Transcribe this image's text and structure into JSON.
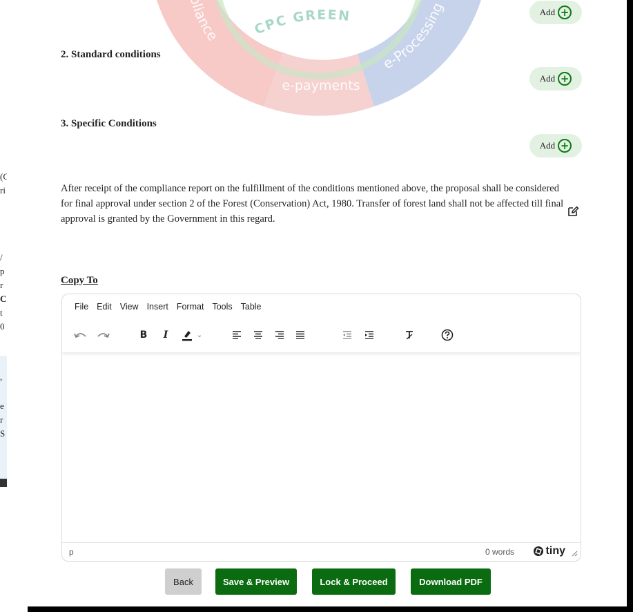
{
  "sections": [
    {
      "title": "2. Standard conditions",
      "add_label": "Add"
    },
    {
      "title": "3. Specific Conditions",
      "add_label": "Add"
    }
  ],
  "top_add_label": "Add",
  "watermark": {
    "center": "CPC GREEN",
    "left": "Compliance",
    "middle": "e-payments",
    "right": "e-Processing",
    "colors": {
      "red": "#f4b8b6",
      "blue": "#b9c7e6",
      "green": "#c9e5c5"
    }
  },
  "paragraph": "After receipt of the compliance report on the fulfillment of the conditions mentioned above, the proposal shall be considered for final approval under section 2 of the Forest (Conservation) Act, 1980. Transfer of forest land shall not be affected till final approval is granted by the Government in this regard.",
  "copy_to_label": "Copy To",
  "editor": {
    "menus": [
      "File",
      "Edit",
      "View",
      "Insert",
      "Format",
      "Tools",
      "Table"
    ],
    "toolbar": [
      "undo-icon",
      "redo-icon",
      "bold-icon",
      "italic-icon",
      "highlight-icon",
      "dropdown-icon",
      "align-left-icon",
      "align-center-icon",
      "align-right-icon",
      "align-justify-icon",
      "outdent-icon",
      "indent-icon",
      "clear-format-icon",
      "help-icon"
    ],
    "status_path": "p",
    "word_count": "0 words",
    "brand": "tiny"
  },
  "buttons": {
    "back": "Back",
    "save_preview": "Save & Preview",
    "lock_proceed": "Lock & Proceed",
    "download_pdf": "Download PDF"
  },
  "colors": {
    "accent": "#0b6b10",
    "add_bg": "#e3f1e3"
  }
}
